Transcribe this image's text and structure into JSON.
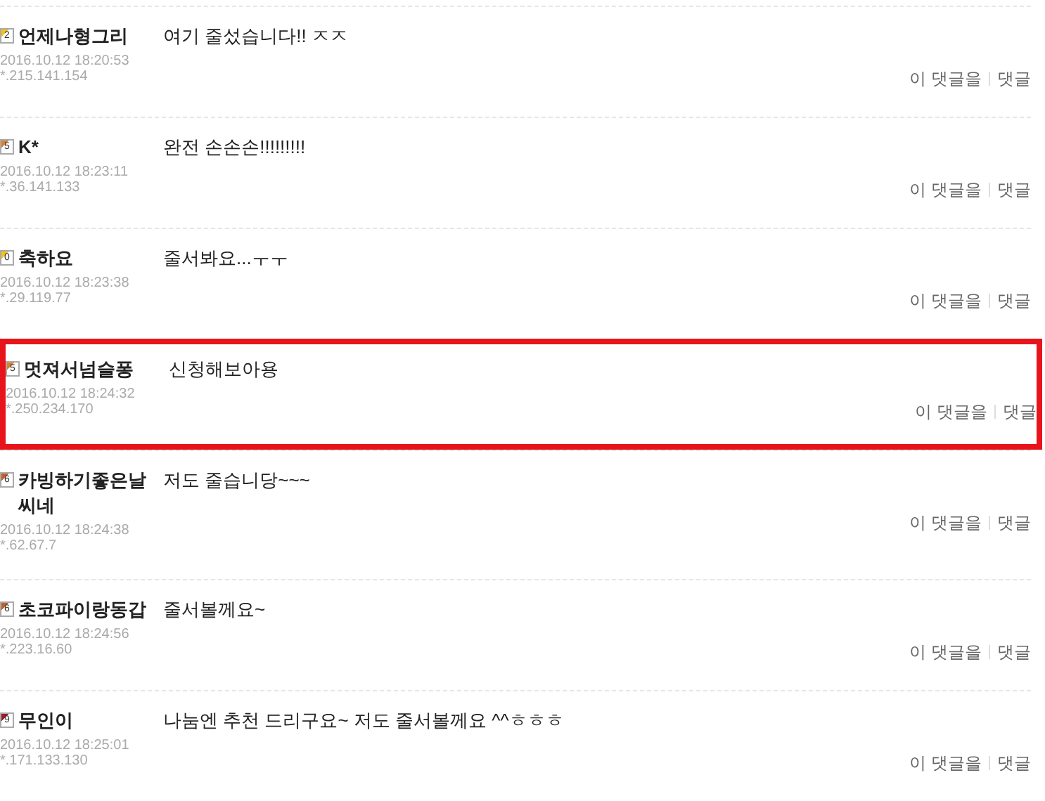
{
  "comments": [
    {
      "level": "2",
      "color": "#f0c419",
      "author": "언제나형그리",
      "date": "2016.10.12 18:20:53",
      "ip": "*.215.141.154",
      "text": "여기 줄섰습니다!! ㅈㅈ",
      "actions": [
        "이 댓글을",
        "댓글"
      ],
      "highlighted": false
    },
    {
      "level": "5",
      "color": "#d9822b",
      "author": "K*",
      "date": "2016.10.12 18:23:11",
      "ip": "*.36.141.133",
      "text": "완전 손손손!!!!!!!!!",
      "actions": [
        "이 댓글을",
        "댓글"
      ],
      "highlighted": false
    },
    {
      "level": "0",
      "color": "#f0c419",
      "author": "축하요",
      "date": "2016.10.12 18:23:38",
      "ip": "*.29.119.77",
      "text": "줄서봐요...ㅜㅜ",
      "actions": [
        "이 댓글을",
        "댓글"
      ],
      "highlighted": false
    },
    {
      "level": "5",
      "color": "#d9822b",
      "author": "멋져서넘슬퐁",
      "date": "2016.10.12 18:24:32",
      "ip": "*.250.234.170",
      "text": "신청해보아용",
      "actions": [
        "이 댓글을",
        "댓글"
      ],
      "highlighted": true
    },
    {
      "level": "6",
      "color": "#c0602a",
      "author": "카빙하기좋은날씨네",
      "date": "2016.10.12 18:24:38",
      "ip": "*.62.67.7",
      "text": "저도 줄습니당~~~",
      "actions": [
        "이 댓글을",
        "댓글"
      ],
      "highlighted": false
    },
    {
      "level": "6",
      "color": "#c0602a",
      "author": "초코파이랑동갑",
      "date": "2016.10.12 18:24:56",
      "ip": "*.223.16.60",
      "text": "줄서볼께요~",
      "actions": [
        "이 댓글을",
        "댓글"
      ],
      "highlighted": false
    },
    {
      "level": "9",
      "color": "#9b1c2c",
      "author": "무인이",
      "date": "2016.10.12 18:25:01",
      "ip": "*.171.133.130",
      "text": "나눔엔 추천 드리구요~ 저도 줄서볼께요 ^^ㅎㅎㅎ",
      "actions": [
        "이 댓글을",
        "댓글"
      ],
      "highlighted": false
    }
  ]
}
